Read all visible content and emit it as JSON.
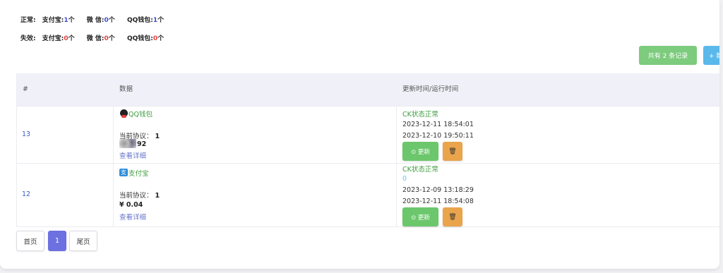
{
  "stats": {
    "normal": {
      "label": "正常:",
      "items": [
        {
          "name": "支付宝:",
          "count": "1",
          "unit": "个"
        },
        {
          "name": "微 信:",
          "count": "0",
          "unit": "个"
        },
        {
          "name": "QQ钱包:",
          "count": "1",
          "unit": "个"
        }
      ]
    },
    "invalid": {
      "label": "失效:",
      "items": [
        {
          "name": "支付宝:",
          "count": "0",
          "unit": "个"
        },
        {
          "name": "微 信:",
          "count": "0",
          "unit": "个"
        },
        {
          "name": "QQ钱包:",
          "count": "0",
          "unit": "个"
        }
      ]
    }
  },
  "toolbar": {
    "total_label": "共有 2 条记录",
    "new_label": "+ 新"
  },
  "table": {
    "headers": [
      "#",
      "数据",
      "更新时间/运行时间"
    ],
    "rows": [
      {
        "id": "13",
        "channel": "QQ钱包",
        "protocol_label": "当前协议：",
        "protocol": "1",
        "amount": "92",
        "detail": "查看详细",
        "status": "CK状态正常",
        "time1": "2023-12-11 18:54:01",
        "time2": "2023-12-10 19:50:11",
        "update": "⊙ 更新",
        "delete": "🗑"
      },
      {
        "id": "12",
        "channel": "支付宝",
        "protocol_label": "当前协议：",
        "protocol": "1",
        "amount": "¥ 0.04",
        "detail": "查看详细",
        "status": "CK状态正常",
        "extra": "0",
        "time1": "2023-12-09 13:18:29",
        "time2": "2023-12-11 18:54:08",
        "update": "⊙ 更新",
        "delete": "🗑"
      }
    ]
  },
  "pagination": {
    "first": "首页",
    "current": "1",
    "last": "尾页"
  },
  "icons": {
    "qq": "qq-penguin-icon",
    "alipay": "alipay-icon",
    "refresh": "refresh-icon",
    "trash": "trash-icon"
  },
  "colors": {
    "green": "#7dcb7d",
    "blue": "#5bb8ea",
    "orange": "#eaa44b",
    "active_page": "#6c70e0"
  }
}
